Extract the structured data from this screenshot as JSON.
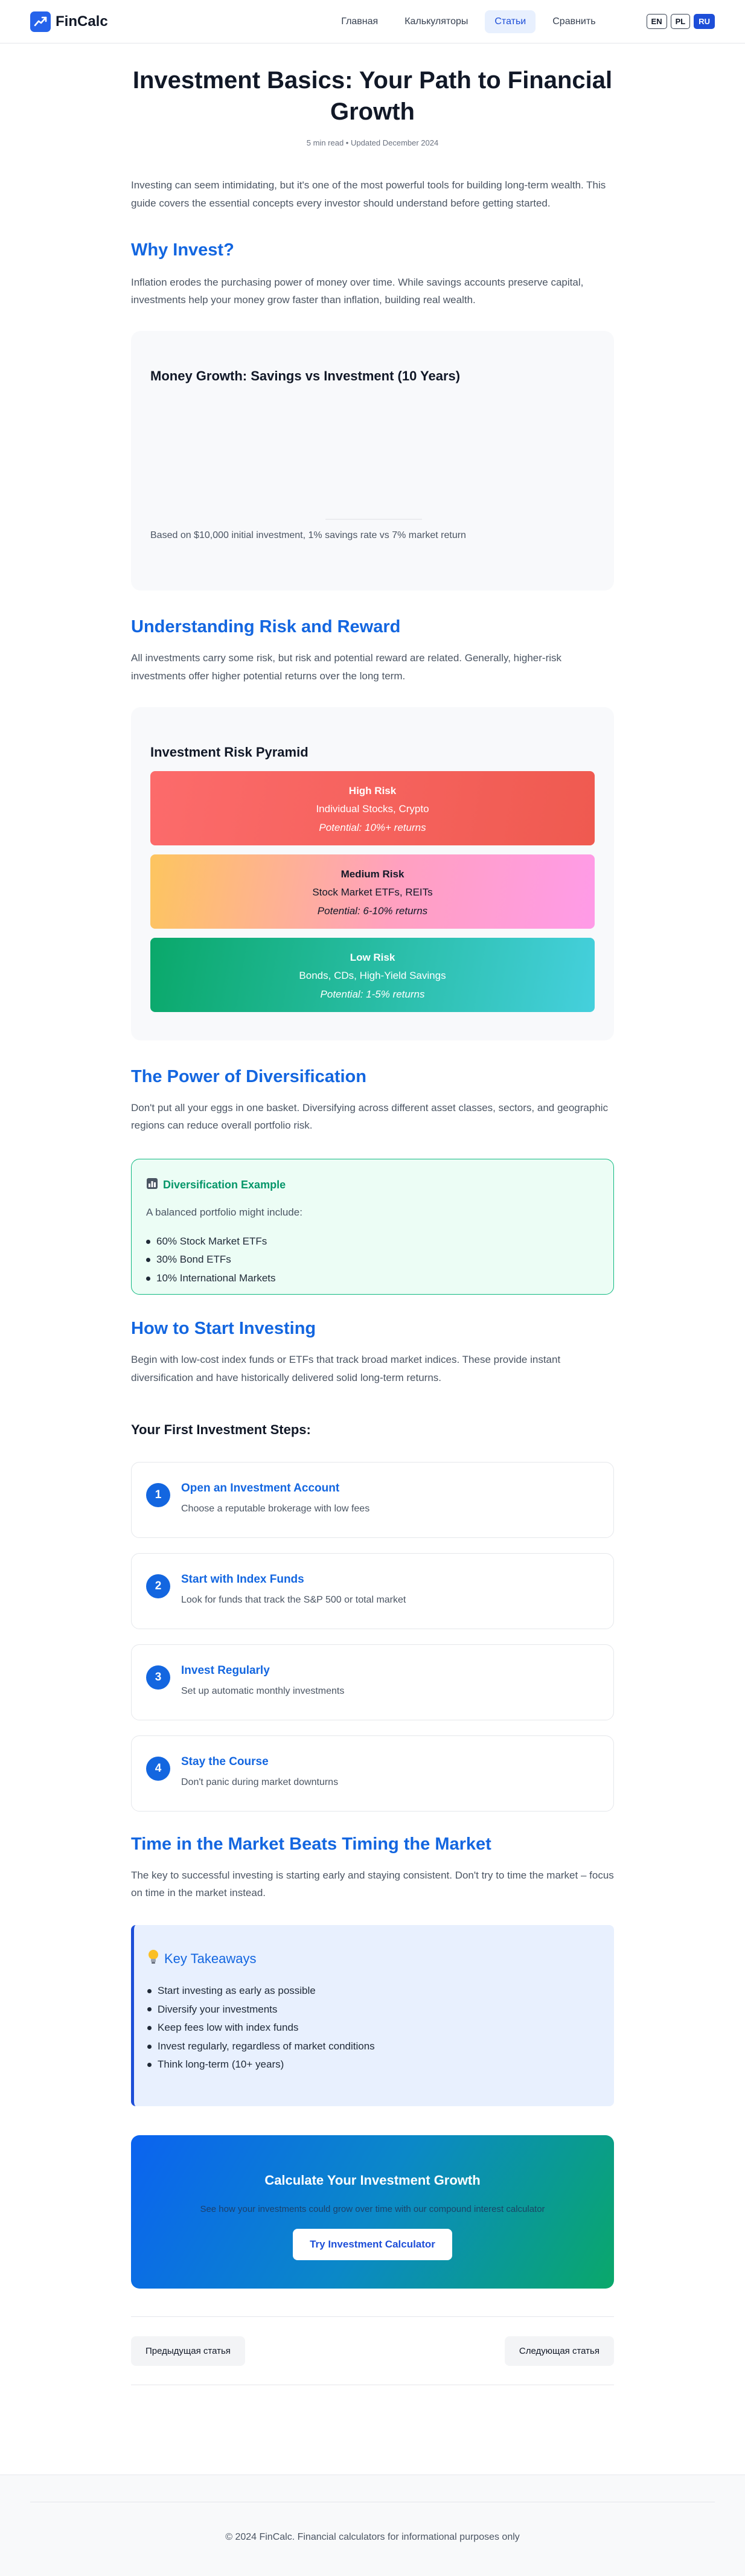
{
  "header": {
    "brand": "FinCalc",
    "nav": [
      "Главная",
      "Калькуляторы",
      "Статьи",
      "Сравнить"
    ],
    "active_nav": "Статьи",
    "languages": [
      "EN",
      "PL",
      "RU"
    ],
    "active_language": "RU"
  },
  "article": {
    "title": "Investment Basics: Your Path to Financial Growth",
    "meta": "5 min read • Updated December 2024",
    "intro": "Investing can seem intimidating, but it's one of the most powerful tools for building long-term wealth. This guide covers the essential concepts every investor should understand before getting started.",
    "why": {
      "heading": "Why Invest?",
      "text": "Inflation erodes the purchasing power of money over time. While savings accounts preserve capital, investments help your money grow faster than inflation, building real wealth."
    },
    "growth_chart": {
      "title": "Money Growth: Savings vs Investment (10 Years)",
      "note": "Based on $10,000 initial investment, 1% savings rate vs 7% market return"
    },
    "risk": {
      "heading": "Understanding Risk and Reward",
      "text": "All investments carry some risk, but risk and potential reward are related. Generally, higher-risk investments offer higher potential returns over the long term.",
      "pyramid_title": "Investment Risk Pyramid",
      "levels": [
        {
          "name": "High Risk",
          "examples": "Individual Stocks, Crypto",
          "potential": "Potential: 10%+ returns"
        },
        {
          "name": "Medium Risk",
          "examples": "Stock Market ETFs, REITs",
          "potential": "Potential: 6-10% returns"
        },
        {
          "name": "Low Risk",
          "examples": "Bonds, CDs, High-Yield Savings",
          "potential": "Potential: 1-5% returns"
        }
      ]
    },
    "diversification": {
      "heading": "The Power of Diversification",
      "text": "Don't put all your eggs in one basket. Diversifying across different asset classes, sectors, and geographic regions can reduce overall portfolio risk.",
      "box_icon": "chart-icon",
      "box_title": "Diversification Example",
      "box_intro": "A balanced portfolio might include:",
      "items": [
        "60% Stock Market ETFs",
        "30% Bond ETFs",
        "10% International Markets"
      ]
    },
    "start": {
      "heading": "How to Start Investing",
      "text": "Begin with low-cost index funds or ETFs that track broad market indices. These provide instant diversification and have historically delivered solid long-term returns.",
      "steps_heading": "Your First Investment Steps:",
      "steps": [
        {
          "num": "1",
          "title": "Open an Investment Account",
          "desc": "Choose a reputable brokerage with low fees"
        },
        {
          "num": "2",
          "title": "Start with Index Funds",
          "desc": "Look for funds that track the S&P 500 or total market"
        },
        {
          "num": "3",
          "title": "Invest Regularly",
          "desc": "Set up automatic monthly investments"
        },
        {
          "num": "4",
          "title": "Stay the Course",
          "desc": "Don't panic during market downturns"
        }
      ]
    },
    "timing": {
      "heading": "Time in the Market Beats Timing the Market",
      "text": "The key to successful investing is starting early and staying consistent. Don't try to time the market – focus on time in the market instead."
    },
    "takeaways": {
      "icon": "lightbulb-icon",
      "title": "Key Takeaways",
      "items": [
        "Start investing as early as possible",
        "Diversify your investments",
        "Keep fees low with index funds",
        "Invest regularly, regardless of market conditions",
        "Think long-term (10+ years)"
      ]
    },
    "cta": {
      "title": "Calculate Your Investment Growth",
      "subtitle": "See how your investments could grow over time with our compound interest calculator",
      "button": "Try Investment Calculator"
    },
    "pager": {
      "prev": "Предыдущая статья",
      "next": "Следующая статья"
    }
  },
  "footer": {
    "text": "© 2024 FinCalc. Financial calculators for informational purposes only"
  },
  "colors": {
    "accent": "#1366e0",
    "high_risk": "#f25c54",
    "medium_risk_start": "#fdc55f",
    "medium_risk_end": "#ff9be8",
    "low_risk_start": "#0aa86a",
    "low_risk_end": "#45d0dd",
    "diversification": "#10b981"
  }
}
